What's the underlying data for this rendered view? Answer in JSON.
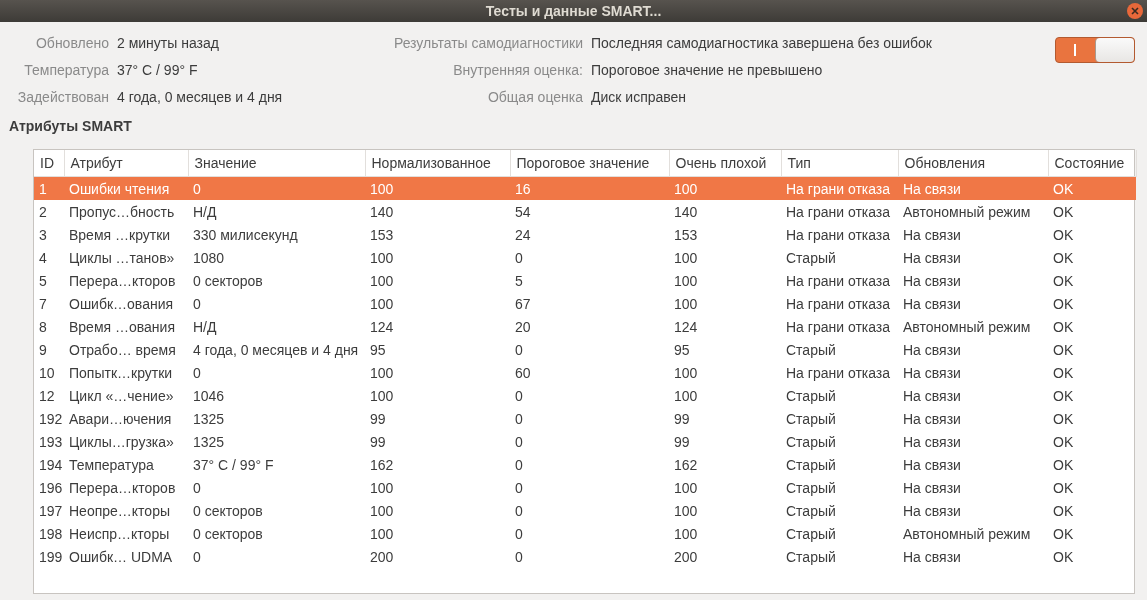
{
  "window": {
    "title": "Тесты и данные SMART..."
  },
  "info_left": [
    {
      "label": "Обновлено",
      "value": "2 минуты назад"
    },
    {
      "label": "Температура",
      "value": "37° C / 99° F"
    },
    {
      "label": "Задействован",
      "value": "4 года, 0 месяцев и 4 дня"
    }
  ],
  "info_right": [
    {
      "label": "Результаты самодиагностики",
      "value": "Последняя самодиагностика завершена без ошибок"
    },
    {
      "label": "Внутренняя оценка:",
      "value": "Пороговое значение не превышено"
    },
    {
      "label": "Общая оценка",
      "value": "Диск исправен"
    }
  ],
  "smart_switch": {
    "on": true
  },
  "section_title": "Атрибуты SMART",
  "table": {
    "columns": [
      "ID",
      "Атрибут",
      "Значение",
      "Нормализованное",
      "Пороговое значение",
      "Очень плохой",
      "Тип",
      "Обновления",
      "Состояние"
    ],
    "rows": [
      {
        "selected": true,
        "cells": [
          "1",
          "Ошибки чтения",
          "0",
          "100",
          "16",
          "100",
          "На грани отказа",
          "На связи",
          "OK"
        ]
      },
      {
        "selected": false,
        "cells": [
          "2",
          "Пропус…бность",
          "Н/Д",
          "140",
          "54",
          "140",
          "На грани отказа",
          "Автономный режим",
          "OK"
        ]
      },
      {
        "selected": false,
        "cells": [
          "3",
          "Время …крутки",
          "330 милисекунд",
          "153",
          "24",
          "153",
          "На грани отказа",
          "На связи",
          "OK"
        ]
      },
      {
        "selected": false,
        "cells": [
          "4",
          "Циклы …танов»",
          "1080",
          "100",
          "0",
          "100",
          "Старый",
          "На связи",
          "OK"
        ]
      },
      {
        "selected": false,
        "cells": [
          "5",
          "Перера…кторов",
          "0 секторов",
          "100",
          "5",
          "100",
          "На грани отказа",
          "На связи",
          "OK"
        ]
      },
      {
        "selected": false,
        "cells": [
          "7",
          "Ошибк…ования",
          "0",
          "100",
          "67",
          "100",
          "На грани отказа",
          "На связи",
          "OK"
        ]
      },
      {
        "selected": false,
        "cells": [
          "8",
          "Время …ования",
          "Н/Д",
          "124",
          "20",
          "124",
          "На грани отказа",
          "Автономный режим",
          "OK"
        ]
      },
      {
        "selected": false,
        "cells": [
          "9",
          "Отрабо… время",
          "4 года, 0 месяцев и 4 дня",
          "95",
          "0",
          "95",
          "Старый",
          "На связи",
          "OK"
        ]
      },
      {
        "selected": false,
        "cells": [
          "10",
          "Попытк…крутки",
          "0",
          "100",
          "60",
          "100",
          "На грани отказа",
          "На связи",
          "OK"
        ]
      },
      {
        "selected": false,
        "cells": [
          "12",
          "Цикл «…чение»",
          "1046",
          "100",
          "0",
          "100",
          "Старый",
          "На связи",
          "OK"
        ]
      },
      {
        "selected": false,
        "cells": [
          "192",
          "Авари…ючения",
          "1325",
          "99",
          "0",
          "99",
          "Старый",
          "На связи",
          "OK"
        ]
      },
      {
        "selected": false,
        "cells": [
          "193",
          "Циклы…грузка»",
          "1325",
          "99",
          "0",
          "99",
          "Старый",
          "На связи",
          "OK"
        ]
      },
      {
        "selected": false,
        "cells": [
          "194",
          "Температура",
          "37° C / 99° F",
          "162",
          "0",
          "162",
          "Старый",
          "На связи",
          "OK"
        ]
      },
      {
        "selected": false,
        "cells": [
          "196",
          "Перера…кторов",
          "0",
          "100",
          "0",
          "100",
          "Старый",
          "На связи",
          "OK"
        ]
      },
      {
        "selected": false,
        "cells": [
          "197",
          "Неопре…кторы",
          "0 секторов",
          "100",
          "0",
          "100",
          "Старый",
          "На связи",
          "OK"
        ]
      },
      {
        "selected": false,
        "cells": [
          "198",
          "Неиспр…кторы",
          "0 секторов",
          "100",
          "0",
          "100",
          "Старый",
          "Автономный режим",
          "OK"
        ]
      },
      {
        "selected": false,
        "cells": [
          "199",
          "Ошибк… UDMA",
          "0",
          "200",
          "0",
          "200",
          "Старый",
          "На связи",
          "OK"
        ]
      }
    ]
  }
}
